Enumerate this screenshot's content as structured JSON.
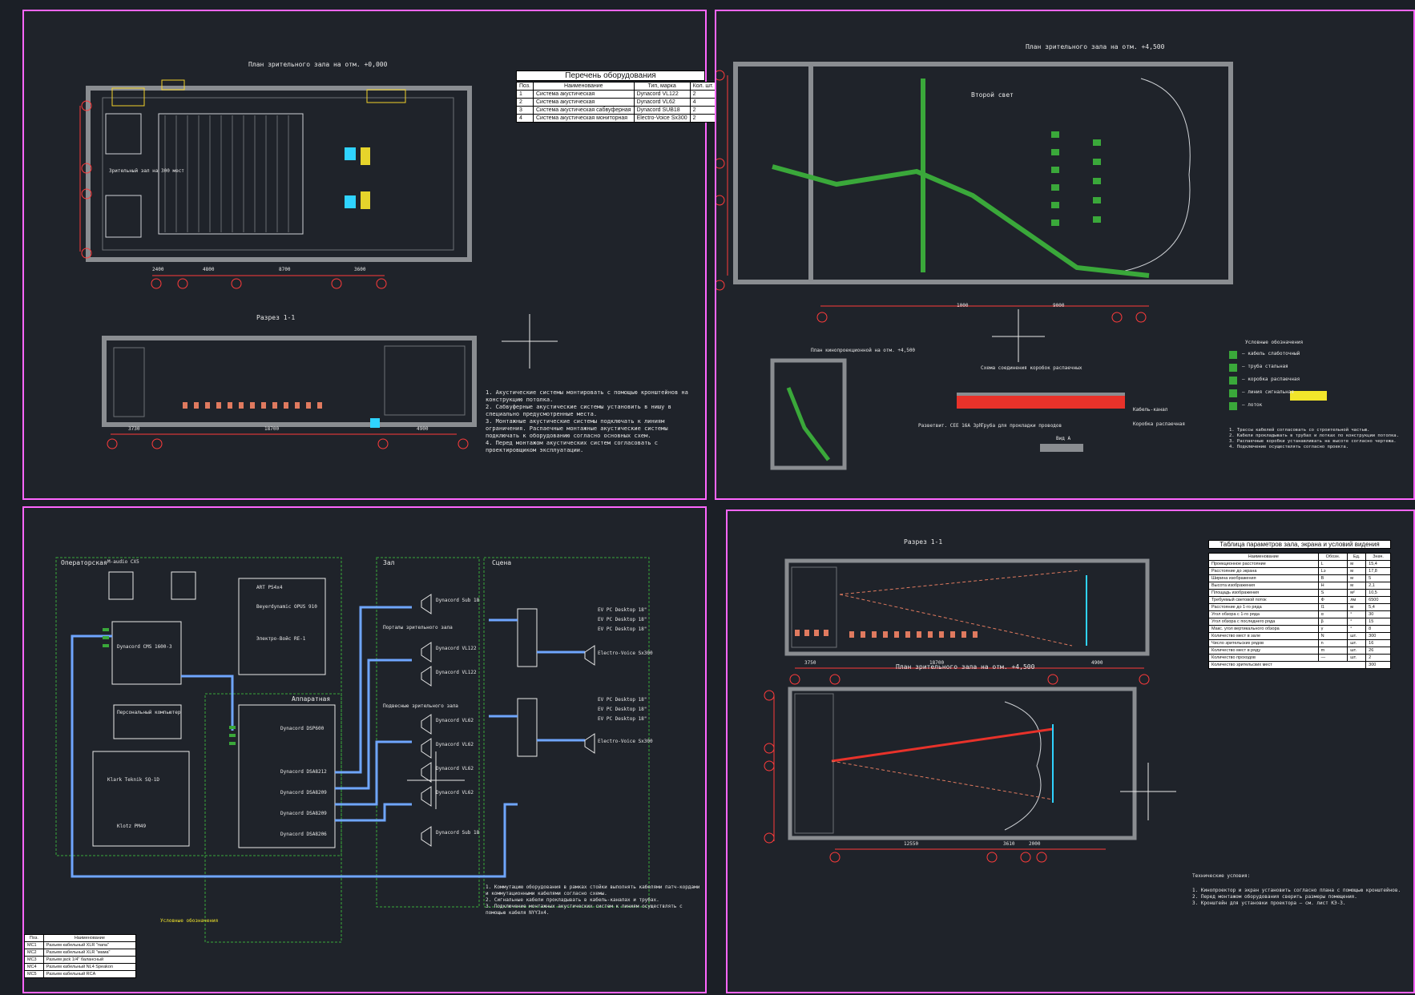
{
  "sheets": {
    "tl": {
      "plan_title": "План зрительного зала на отм. +0,000",
      "section_title": "Разрез 1-1",
      "hall_label": "Зрительный зал на 300 мест",
      "notes": [
        "1. Акустические системы монтировать с помощью кронштейнов на конструкцию потолка.",
        "2. Сабвуферные акустические системы установить в нишу в специально предусмотренные места.",
        "3. Монтажные акустические системы подключать к линиям ограничения. Распаечные монтажные акустические системы подключать к оборудованию согласно основных схем.",
        "4. Перед монтажом акустических систем согласовать с проектировщиком эксплуатации."
      ],
      "dims_plan": [
        "2400",
        "4800",
        "8700",
        "3600"
      ],
      "dims_section": [
        "3730",
        "18700",
        "4900"
      ],
      "axes_x": [
        "1",
        "2",
        "3",
        "4",
        "5"
      ],
      "axes_y": [
        "А",
        "Б",
        "В",
        "Г"
      ],
      "equipment_table": {
        "caption": "Перечень оборудования",
        "headers": [
          "Поз.",
          "Наименование",
          "Тип, марка",
          "Кол. шт."
        ],
        "rows": [
          [
            "1",
            "Система акустическая",
            "Dynacord VL122",
            "2"
          ],
          [
            "2",
            "Система акустическая",
            "Dynacord VL62",
            "4"
          ],
          [
            "3",
            "Система акустическая сабвуферная",
            "Dynacord SUB18",
            "2"
          ],
          [
            "4",
            "Система акустическая мониторная",
            "Electro-Voice Sx300",
            "2"
          ]
        ]
      }
    },
    "tr": {
      "plan_title": "План зрительного зала на отм. +4,500",
      "second_light": "Второй свет",
      "small_plan_title": "План кинопроекционной на отм. +4,500",
      "box_title": "Схема соединения коробок распаечных",
      "view_a": "Вид А",
      "cable_labels": [
        "Кабель-канал",
        "Коробка распаечная",
        "Разветвит. СЕЕ 16А 3ph",
        "Труба для прокладки проводов"
      ],
      "legend_title": "Условные обозначения",
      "legend_items": [
        "— кабель слаботочный",
        "— труба стальная",
        "— коробка распаечная",
        "— линия сигнальная",
        "— лоток"
      ],
      "notes": [
        "1. Трассы кабелей согласовать со строительной частью.",
        "2. Кабели прокладывать в трубах и лотках по конструкции потолка.",
        "3. Распаечные коробки устанавливать на высоте согласно чертежа.",
        "4. Подключение осуществлять согласно проекта."
      ],
      "dims": [
        "1000",
        "9000"
      ]
    },
    "bl": {
      "rooms": [
        "Операторская",
        "Зал",
        "Сцена",
        "Аппаратная"
      ],
      "devices": [
        "Dynacord CMS 1600-3",
        "Персональный компьютер",
        "Dynacord DSP600",
        "Dynacord DSA8212",
        "Dynacord DSA8209",
        "Dynacord DSA8209",
        "Dynacord DSA8206",
        "ART PS4x4",
        "Klark Teknik SQ-1D",
        "Klotz PM49",
        "M-audio CX5",
        "Beyerdynamic OPUS 910",
        "Электро-Войс RE-1"
      ],
      "speakers": [
        "Dynacord Sub 18",
        "Dynacord VL122",
        "Dynacord VL122",
        "Dynacord VL62",
        "Dynacord VL62",
        "Dynacord VL62",
        "Dynacord VL62",
        "Dynacord Sub 18"
      ],
      "stage": [
        "EV PC Desktop 18\"",
        "EV PC Desktop 18\"",
        "EV PC Desktop 18\"",
        "Electro-Voice Sx300",
        "EV PC Desktop 18\"",
        "EV PC Desktop 18\"",
        "EV PC Desktop 18\"",
        "Electro-Voice Sx300"
      ],
      "groups": [
        "Порталы зрительного зала",
        "Подвесные зрительного зала"
      ],
      "notes": [
        "1. Коммутацию оборудования в рамках стойки выполнять кабелями патч-кордами и коммутационными кабелями согласно схемы.",
        "2. Сигнальные кабели прокладывать в кабель-каналах и трубах.",
        "3. Подключение монтажных акустических систем к линиям осуществлять с помощью кабеля NYY3х4."
      ],
      "legend_title": "Условные обозначения",
      "cable_table": {
        "headers": [
          "Поз.",
          "Наименование"
        ],
        "rows": [
          [
            "MC1",
            "Разъем кабельный XLR \"папа\""
          ],
          [
            "MC2",
            "Разъем кабельный XLR \"мама\""
          ],
          [
            "MC3",
            "Разъем jack 1/4\" балансный"
          ],
          [
            "MC4",
            "Разъем кабельный NL4 Speakon"
          ],
          [
            "MC5",
            "Разъем кабельный RCA"
          ]
        ]
      }
    },
    "br": {
      "section_title": "Разрез 1-1",
      "plan_title": "План зрительного зала на отм. +4,500",
      "param_table": {
        "caption": "Таблица параметров зала, экрана и условий видения",
        "headers": [
          "Наименование",
          "Обозн.",
          "Ед.",
          "Знач."
        ],
        "rows": [
          [
            "Проекционное расстояние",
            "L",
            "м",
            "15,4"
          ],
          [
            "Расстояние до экрана",
            "Lэ",
            "м",
            "17,8"
          ],
          [
            "Ширина изображения",
            "B",
            "м",
            "5"
          ],
          [
            "Высота изображения",
            "H",
            "м",
            "2,1"
          ],
          [
            "Площадь изображения",
            "S",
            "м²",
            "10,5"
          ],
          [
            "Требуемый световой поток",
            "Ф",
            "лм",
            "6500"
          ],
          [
            "Расстояние до 1-го ряда",
            "l1",
            "м",
            "5,4"
          ],
          [
            "Угол обзора с 1-го ряда",
            "α",
            "°",
            "30"
          ],
          [
            "Угол обзора с последнего ряда",
            "β",
            "°",
            "15"
          ],
          [
            "Макс. угол вертикального обзора",
            "γ",
            "°",
            "8"
          ],
          [
            "Количество мест в зале",
            "N",
            "шт.",
            "300"
          ],
          [
            "Число зрительских рядов",
            "n",
            "шт.",
            "16"
          ],
          [
            "Количество мест в ряду",
            "m",
            "шт.",
            "26"
          ],
          [
            "Количество проходов",
            "—",
            "шт.",
            "2"
          ]
        ],
        "total_label": "Количество зрительских мест",
        "total_value": "300"
      },
      "tech_title": "Технические условия:",
      "tech_notes": [
        "1. Кинопроектор и экран установить согласно плана с помощью кронштейнов.",
        "2. Перед монтажом оборудования сверить размеры помещения.",
        "3. Кронштейн для установки проектора — см. лист КЭ-3."
      ],
      "dims_section": [
        "3750",
        "18700",
        "4900"
      ],
      "dims_plan": [
        "12550",
        "3610",
        "2000"
      ]
    }
  }
}
